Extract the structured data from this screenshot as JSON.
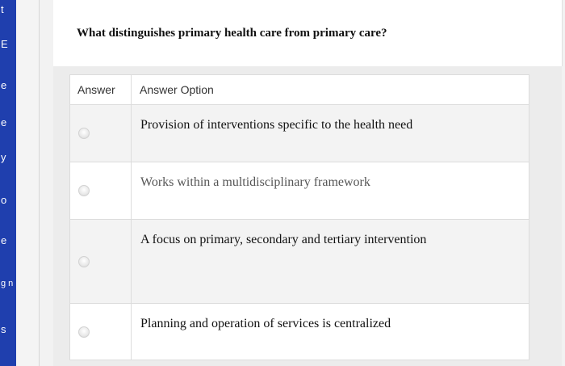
{
  "sidebar": {
    "items": [
      "t",
      "E",
      "e",
      "e",
      "y",
      "o",
      "e",
      "g n",
      "s"
    ]
  },
  "question": {
    "text": "What distinguishes primary health care from primary care?"
  },
  "table": {
    "headers": {
      "answer": "Answer",
      "option": "Answer Option"
    },
    "options": [
      "Provision of interventions specific to the health need",
      "Works within a multidisciplinary framework",
      "A focus on primary, secondary and tertiary intervention",
      "Planning and operation of services is centralized"
    ]
  },
  "colors": {
    "sidebar": "#1f3fae",
    "background": "#f2f2f2"
  }
}
